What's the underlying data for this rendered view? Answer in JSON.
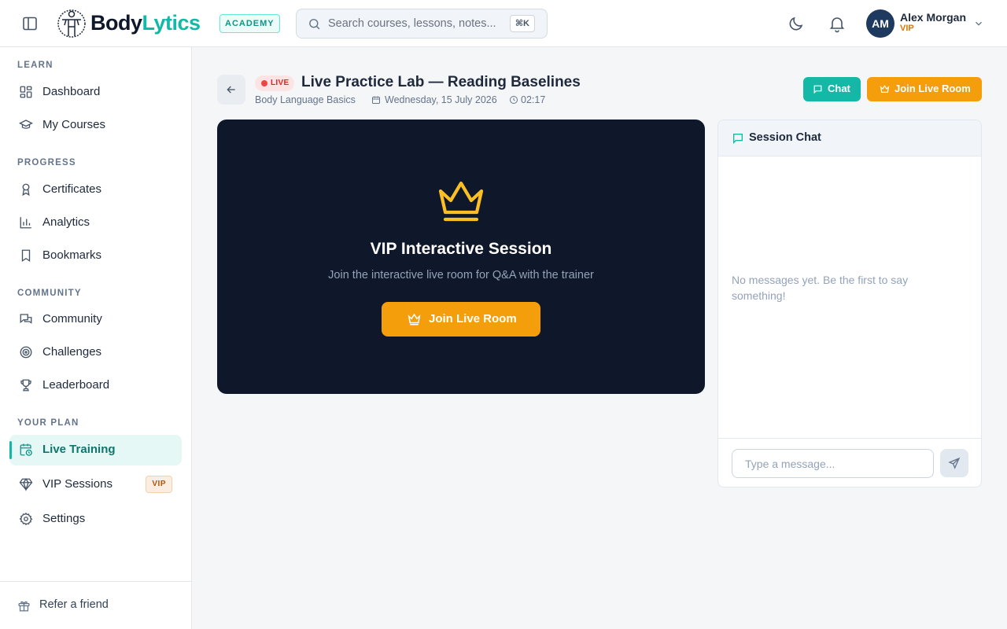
{
  "app": {
    "brand_part1": "Body",
    "brand_part2": "Lytics",
    "badge": "ACADEMY",
    "brand_colors": {
      "dark": "#0f172a",
      "accent": "#14b8a6",
      "vip": "#f59e0b"
    }
  },
  "search": {
    "placeholder": "Search courses, lessons, notes...",
    "shortcut": "⌘K"
  },
  "header": {
    "icons": [
      "sidebar-toggle-icon",
      "moon-icon",
      "bell-icon",
      "chevron-down-icon"
    ],
    "user": {
      "initials": "AM",
      "name": "Alex Morgan",
      "tier": "VIP"
    }
  },
  "sidebar": {
    "sections": [
      {
        "title": "LEARN",
        "items": [
          {
            "label": "Dashboard",
            "icon": "dashboard-icon"
          },
          {
            "label": "My Courses",
            "icon": "graduation-cap-icon"
          }
        ]
      },
      {
        "title": "PROGRESS",
        "items": [
          {
            "label": "Certificates",
            "icon": "award-icon"
          },
          {
            "label": "Analytics",
            "icon": "bar-chart-icon"
          },
          {
            "label": "Bookmarks",
            "icon": "bookmark-icon"
          }
        ]
      },
      {
        "title": "COMMUNITY",
        "items": [
          {
            "label": "Community",
            "icon": "chat-bubbles-icon"
          },
          {
            "label": "Challenges",
            "icon": "target-icon"
          },
          {
            "label": "Leaderboard",
            "icon": "trophy-icon"
          }
        ]
      },
      {
        "title": "YOUR PLAN",
        "items": [
          {
            "label": "Live Training",
            "icon": "calendar-clock-icon",
            "active": true
          },
          {
            "label": "VIP Sessions",
            "icon": "gem-icon",
            "tag": "VIP"
          },
          {
            "label": "Settings",
            "icon": "gear-icon"
          }
        ]
      }
    ],
    "footer": {
      "label": "Refer a friend",
      "icon": "gift-icon"
    }
  },
  "session": {
    "status": "LIVE",
    "title": "Live Practice Lab — Reading Baselines",
    "course": "Body Language Basics",
    "date": "Wednesday, 15 July 2026",
    "time": "02:17",
    "chat_button": "Chat",
    "join_button": "Join Live Room"
  },
  "stage": {
    "icon": "crown-icon",
    "title": "VIP Interactive Session",
    "subtitle": "Join the interactive live room for Q&A with the trainer",
    "button": "Join Live Room"
  },
  "chat": {
    "title": "Session Chat",
    "empty_text": "No messages yet. Be the first to say something!",
    "input_placeholder": "Type a message..."
  }
}
